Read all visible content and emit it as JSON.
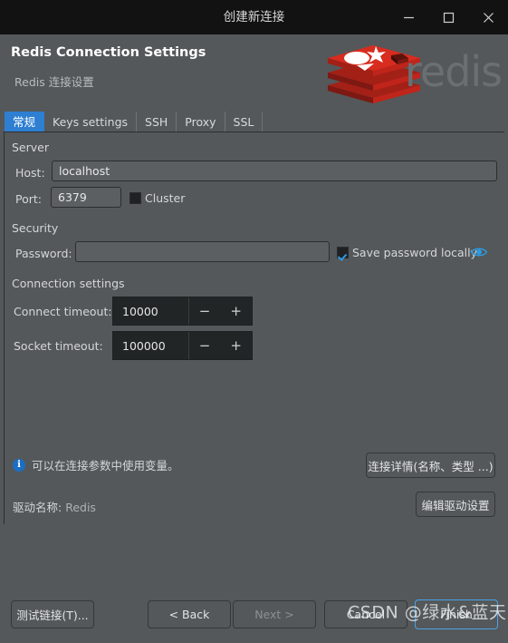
{
  "window": {
    "title": "创建新连接",
    "controls": [
      {
        "name": "minimize",
        "glyph": "minimize-icon"
      },
      {
        "name": "maximize",
        "glyph": "maximize-icon"
      },
      {
        "name": "close",
        "glyph": "close-icon"
      }
    ]
  },
  "header": {
    "title": "Redis Connection Settings",
    "subtitle": "Redis 连接设置",
    "logo_wordmark": "redis",
    "logo_color": "#d82c20",
    "wordmark_color": "#6b6f71"
  },
  "tabs": [
    {
      "label": "常规",
      "active": true
    },
    {
      "label": "Keys settings",
      "active": false
    },
    {
      "label": "SSH",
      "active": false
    },
    {
      "label": "Proxy",
      "active": false
    },
    {
      "label": "SSL",
      "active": false
    }
  ],
  "groups": {
    "server": "Server",
    "security": "Security",
    "connection_settings": "Connection settings"
  },
  "fields": {
    "host_label": "Host:",
    "host_value": "localhost",
    "port_label": "Port:",
    "port_value": "6379",
    "cluster_label": "Cluster",
    "cluster_checked": false,
    "password_label": "Password:",
    "password_value": "",
    "save_password_label": "Save password locally",
    "save_password_checked": true,
    "show_password_icon": "eye-icon",
    "connect_timeout_label": "Connect timeout:",
    "connect_timeout_value": "10000",
    "socket_timeout_label": "Socket timeout:",
    "socket_timeout_value": "100000",
    "minus_glyph": "−",
    "plus_glyph": "+"
  },
  "info": {
    "icon": "info-icon",
    "text": "可以在连接参数中使用变量。"
  },
  "driver": {
    "label": "驱动名称:",
    "value": "Redis"
  },
  "side_buttons": {
    "connection_details": "连接详情(名称、类型 ...)",
    "edit_driver_settings": "编辑驱动设置"
  },
  "footer_buttons": {
    "test_connection": "测试链接(T)...",
    "back": "< Back",
    "next": "Next >",
    "cancel": "Cancel",
    "finish": "Finish"
  },
  "watermark": "CSDN @绿水&蓝天",
  "colors": {
    "dialog_bg": "#54585a",
    "titlebar_bg": "#121212",
    "accent_blue": "#2e7fd1",
    "field_bg": "#5b5f61",
    "spinner_bg": "#222526"
  }
}
